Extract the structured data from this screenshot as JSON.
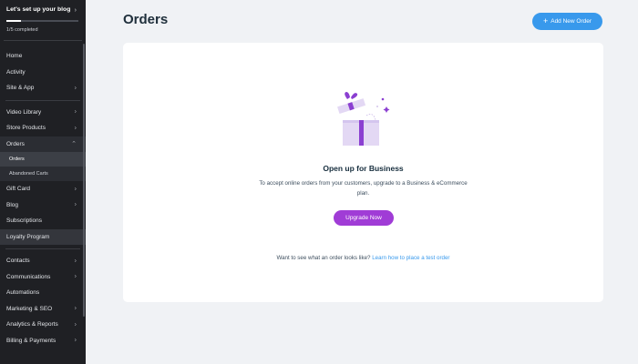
{
  "sidebar": {
    "setup": {
      "title": "Let's set up your blog",
      "progress_text": "1/5 completed",
      "progress_fraction": 0.2
    },
    "group1": [
      {
        "label": "Home",
        "chevron": false
      },
      {
        "label": "Activity",
        "chevron": false
      },
      {
        "label": "Site & App",
        "chevron": true
      }
    ],
    "group2_top": [
      {
        "label": "Video Library",
        "chevron": true
      },
      {
        "label": "Store Products",
        "chevron": true
      }
    ],
    "orders": {
      "label": "Orders",
      "sub_items": [
        {
          "label": "Orders",
          "selected": true
        },
        {
          "label": "Abandoned Carts",
          "selected": false
        }
      ]
    },
    "group2_bottom": [
      {
        "label": "Gift Card",
        "chevron": true
      },
      {
        "label": "Blog",
        "chevron": true
      },
      {
        "label": "Subscriptions",
        "chevron": false
      },
      {
        "label": "Loyalty Program",
        "chevron": false
      }
    ],
    "group3": [
      {
        "label": "Contacts",
        "chevron": true
      },
      {
        "label": "Communications",
        "chevron": true
      },
      {
        "label": "Automations",
        "chevron": false
      },
      {
        "label": "Marketing & SEO",
        "chevron": true
      },
      {
        "label": "Analytics & Reports",
        "chevron": true
      },
      {
        "label": "Billing & Payments",
        "chevron": true
      }
    ]
  },
  "header": {
    "title": "Orders",
    "add_button_label": "Add New Order"
  },
  "empty_state": {
    "title": "Open up for Business",
    "description": "To accept online orders from your customers, upgrade to a Business & eCommerce plan.",
    "upgrade_label": "Upgrade Now",
    "test_prompt": "Want to see what an order looks like?",
    "test_link": "Learn how to place a test order"
  },
  "colors": {
    "sidebar_bg": "#1f2024",
    "primary_blue": "#3899ec",
    "upgrade_purple": "#a03cd6",
    "gift_lavender": "#e3d8f4",
    "gift_ribbon": "#8b3fd1"
  },
  "icons": {
    "add": "plus-icon",
    "chevron": "chevron-right-icon",
    "expanded": "chevron-up-icon",
    "illustration": "gift-box-icon"
  }
}
